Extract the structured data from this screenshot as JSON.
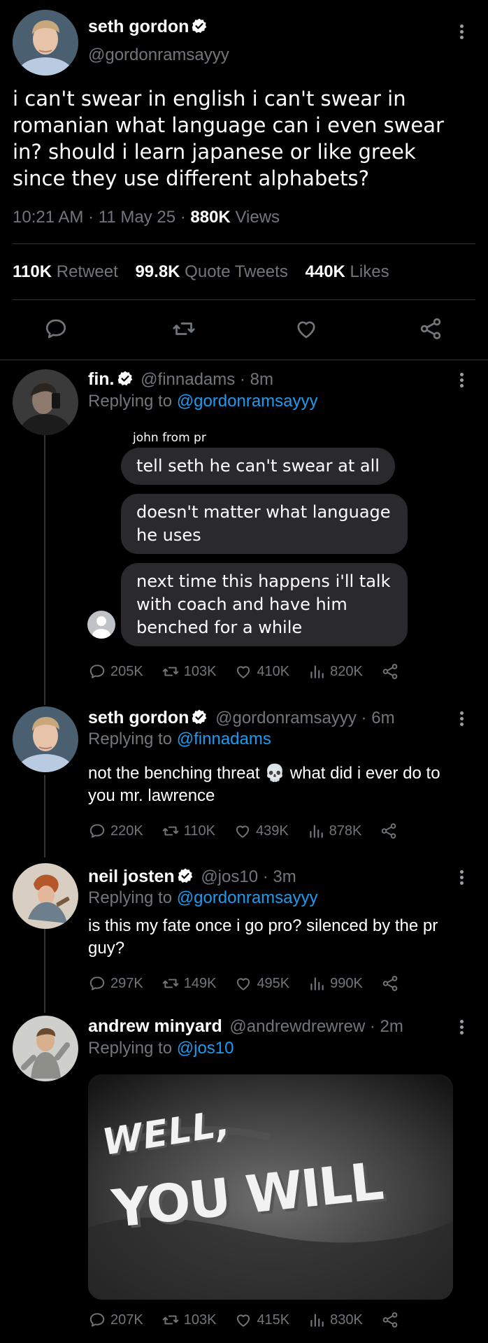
{
  "main_tweet": {
    "display_name": "seth gordon",
    "handle": "@gordonramsayyy",
    "text": "i can't swear in english i can't swear in romanian what language can i even swear in? should i learn japanese or like greek since they use different alphabets?",
    "time": "10:21 AM",
    "date": "11 May 25",
    "views_count": "880K",
    "views_label": "Views",
    "retweets_count": "110K",
    "retweets_label": "Retweet",
    "quotes_count": "99.8K",
    "quotes_label": "Quote Tweets",
    "likes_count": "440K",
    "likes_label": "Likes"
  },
  "replies": [
    {
      "display_name": "fin.",
      "handle": "@finnadams",
      "time": "8m",
      "replying_prefix": "Replying to",
      "replying_to": "@gordonramsayyy",
      "screenshot": {
        "sender": "john from pr",
        "messages": [
          "tell seth he can't swear at all",
          "doesn't matter what language he uses",
          "next time this happens i'll talk with coach and have him benched for a while"
        ]
      },
      "stats": {
        "replies": "205K",
        "retweets": "103K",
        "likes": "410K",
        "views": "820K"
      }
    },
    {
      "display_name": "seth gordon",
      "handle": "@gordonramsayyy",
      "time": "6m",
      "replying_prefix": "Replying to",
      "replying_to": "@finnadams",
      "text_before": "not the benching threat",
      "emoji": "💀",
      "text_after": "what did i ever do to you mr. lawrence",
      "stats": {
        "replies": "220K",
        "retweets": "110K",
        "likes": "439K",
        "views": "878K"
      }
    },
    {
      "display_name": "neil josten",
      "handle": "@jos10",
      "time": "3m",
      "replying_prefix": "Replying to",
      "replying_to": "@gordonramsayyy",
      "text": "is this my fate once i go pro? silenced by the pr guy?",
      "stats": {
        "replies": "297K",
        "retweets": "149K",
        "likes": "495K",
        "views": "990K"
      }
    },
    {
      "display_name": "andrew minyard",
      "handle": "@andrewdrewrew",
      "time": "2m",
      "replying_prefix": "Replying to",
      "replying_to": "@jos10",
      "media_text_line1": "WELL,",
      "media_text_line2": "YOU WILL",
      "stats": {
        "replies": "207K",
        "retweets": "103K",
        "likes": "415K",
        "views": "830K"
      }
    }
  ],
  "colors": {
    "link_blue": "#1d9bf0",
    "muted_grey": "#71767b",
    "bubble": "#2a2a2e",
    "verified": "#ffffff"
  }
}
